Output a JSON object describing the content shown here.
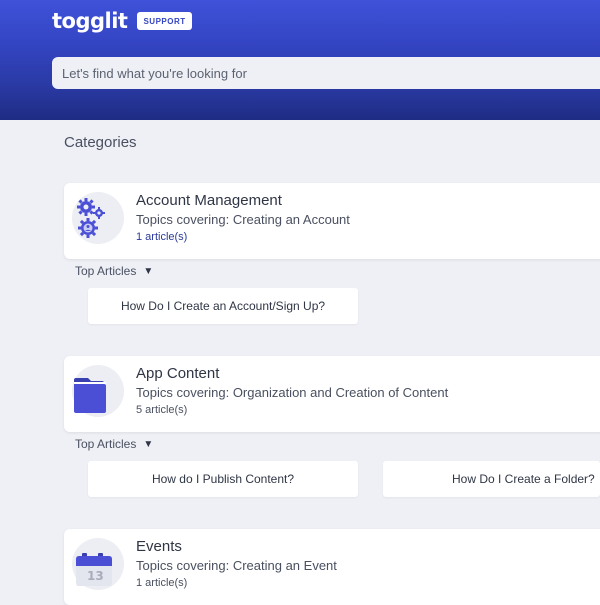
{
  "header": {
    "logo": "togglit",
    "badge": "SUPPORT",
    "search_placeholder": "Let's find what you're looking for"
  },
  "main": {
    "section_title": "Categories",
    "categories": [
      {
        "title": "Account Management",
        "description": "Topics covering: Creating an Account",
        "count": "1 article(s)",
        "icon": "gears-icon",
        "top_articles_label": "Top Articles",
        "articles": [
          "How Do I Create an Account/Sign Up?"
        ]
      },
      {
        "title": "App Content",
        "description": "Topics covering: Organization and Creation of Content",
        "count": "5 article(s)",
        "icon": "folder-icon",
        "top_articles_label": "Top Articles",
        "articles": [
          "How do I Publish Content?",
          "How Do I Create a Folder?"
        ]
      },
      {
        "title": "Events",
        "description": "Topics covering: Creating an Event",
        "count": "1 article(s)",
        "icon": "calendar-icon",
        "calendar_day": "13"
      }
    ]
  },
  "colors": {
    "header_top": "#3f52d9",
    "header_bottom": "#1f2c84",
    "accent": "#4a4fd6",
    "background": "#eef0f6"
  }
}
